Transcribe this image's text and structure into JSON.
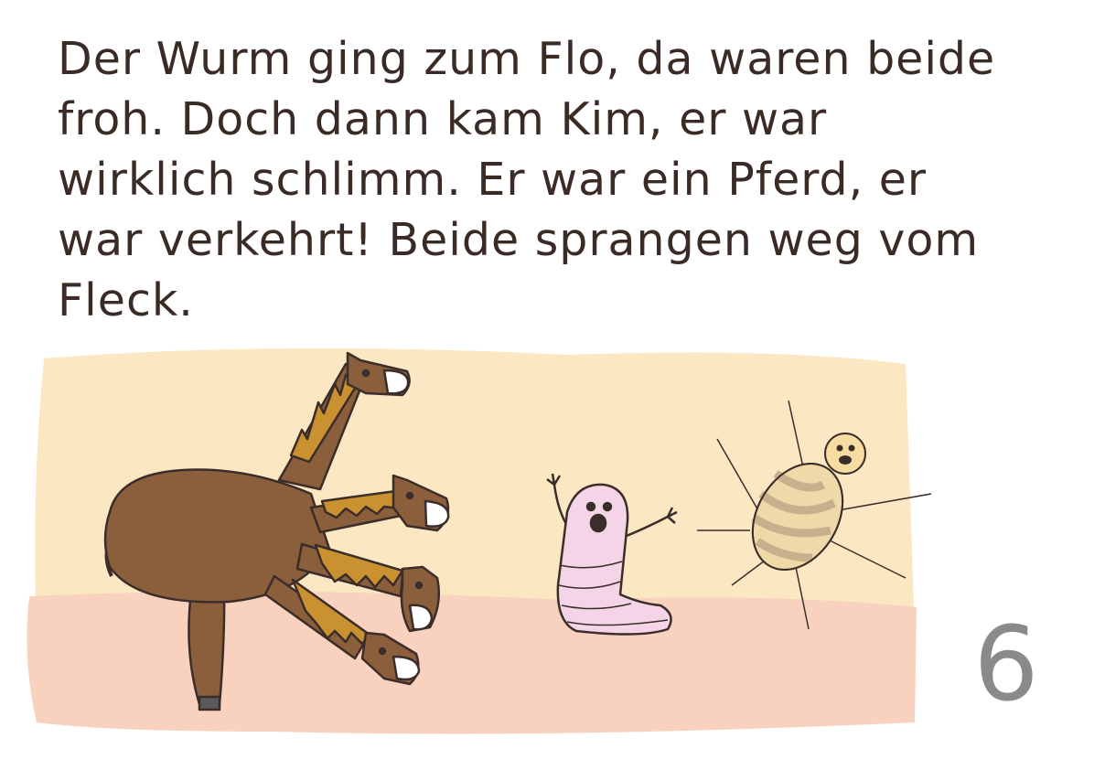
{
  "story": {
    "lines": [
      "Der Wurm ging zum Flo, da waren beide",
      "froh. Doch dann kam Kim, er war",
      "wirklich schlimm. Er war ein Pferd, er",
      "war verkehrt! Beide sprangen weg vom",
      "Fleck."
    ]
  },
  "page": {
    "number": "6"
  },
  "illustration": {
    "characters": [
      "horse-icon",
      "worm-icon",
      "flea-icon"
    ],
    "colors": {
      "sky": "#fbe8c2",
      "ground": "#f9d2bf",
      "horse_body": "#8b5e3c",
      "horse_mane": "#c9912f",
      "worm": "#f4d4e6",
      "flea_body": "#efd9a8",
      "flea_stripes": "#c9b08c",
      "outline": "#3b2d2a"
    }
  }
}
